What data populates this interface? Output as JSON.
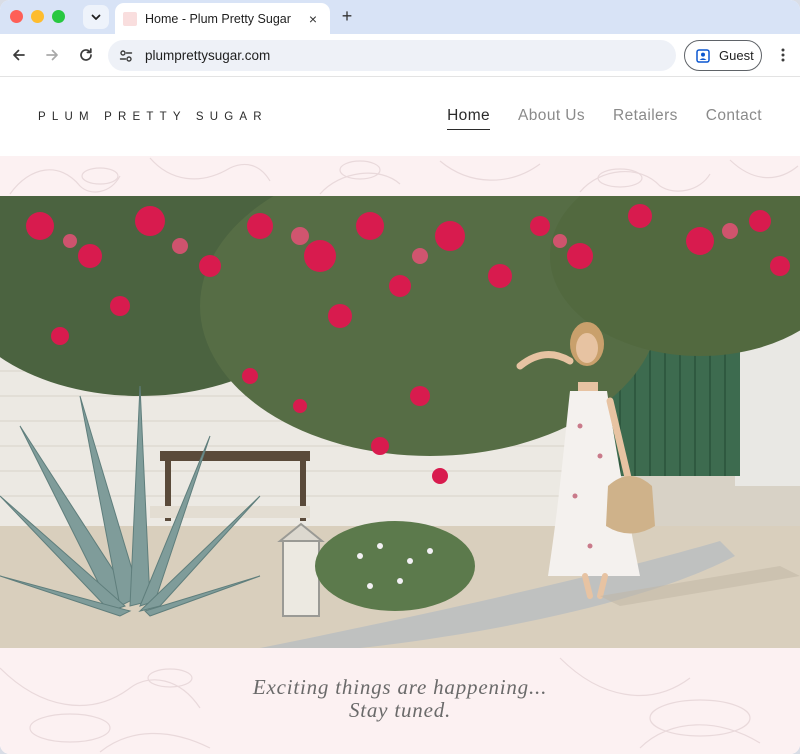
{
  "browser": {
    "tab_title": "Home - Plum Pretty Sugar",
    "tab_close": "×",
    "new_tab": "+",
    "url": "plumprettysugar.com",
    "profile_label": "Guest",
    "icons": [
      "tab-search-icon",
      "back-arrow-icon",
      "forward-arrow-icon",
      "reload-icon",
      "site-info-icon",
      "profile-icon",
      "more-menu-icon"
    ]
  },
  "site": {
    "logo": "PLUM PRETTY SUGAR",
    "nav": [
      {
        "label": "Home",
        "active": true
      },
      {
        "label": "About Us",
        "active": false
      },
      {
        "label": "Retailers",
        "active": false
      },
      {
        "label": "Contact",
        "active": false
      }
    ],
    "tagline_line1": "Exciting things are happening...",
    "tagline_line2": "Stay tuned."
  },
  "colors": {
    "tab_strip": "#d8e3f6",
    "pattern_background": "#fcf1f2",
    "bougainvillea": "#d81b4e",
    "gate_green": "#3d6b4f",
    "text_dark": "#2b2b2b",
    "text_muted": "#8a8a8a"
  }
}
